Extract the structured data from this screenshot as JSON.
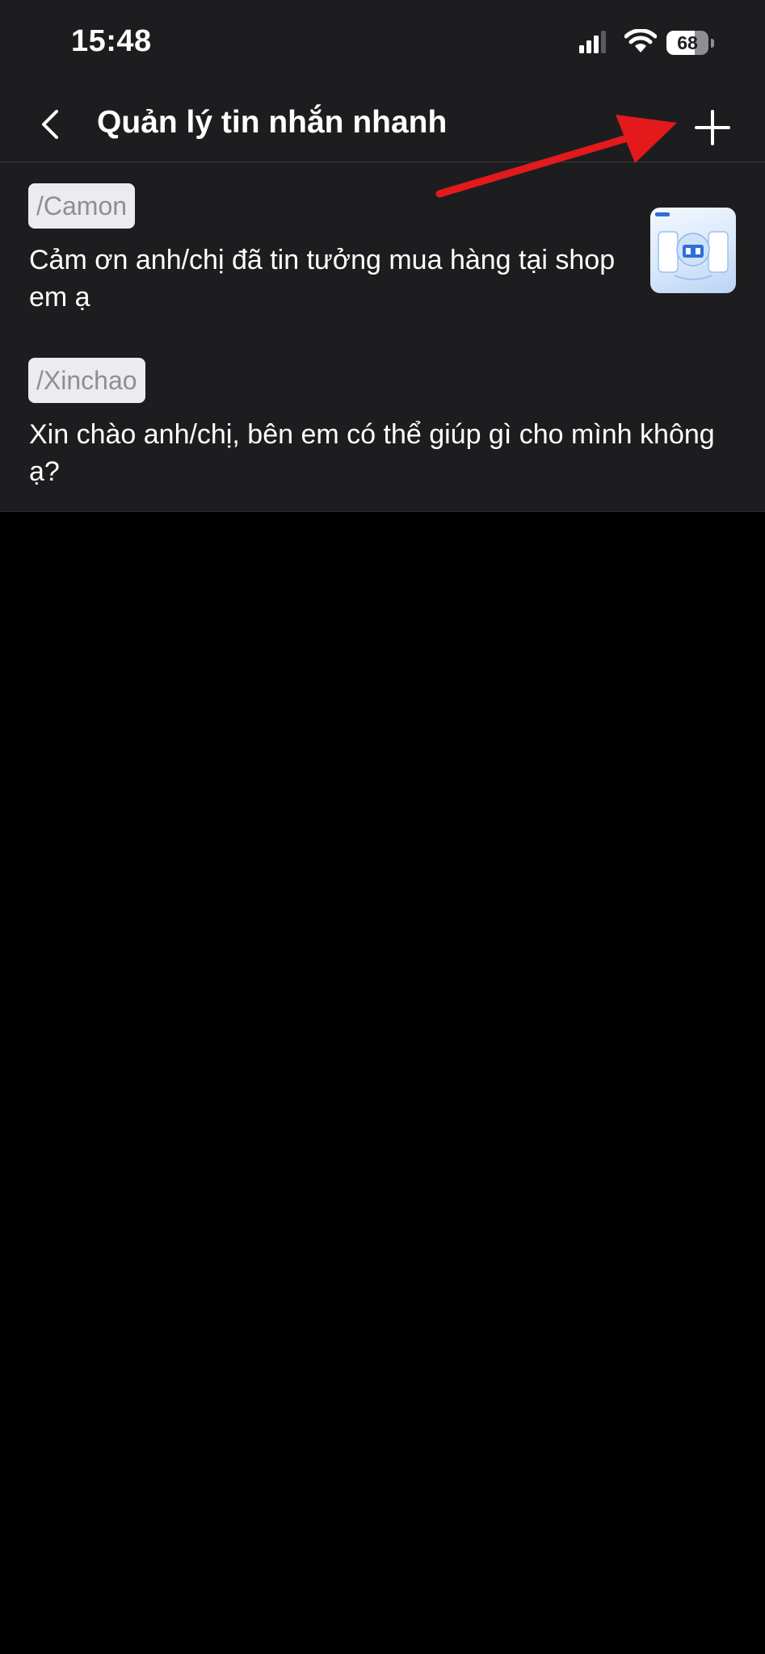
{
  "status_bar": {
    "time": "15:48",
    "battery_percent": "68",
    "battery_level": 0.68,
    "icons": [
      "signal-icon",
      "wifi-icon",
      "battery-icon"
    ]
  },
  "nav": {
    "title": "Quản lý tin nhắn nhanh",
    "back_icon": "chevron-left-icon",
    "add_icon": "plus-icon"
  },
  "quick_messages": [
    {
      "shortcut": "/Camon",
      "text": "Cảm ơn anh/chị đã tin tưởng mua hàng tại shop em ạ",
      "has_image": true
    },
    {
      "shortcut": "/Xinchao",
      "text": "Xin chào anh/chị, bên em có thể giúp gì cho mình không ạ?",
      "has_image": false
    }
  ],
  "colors": {
    "background": "#000000",
    "surface": "#1d1d1f",
    "tag_background": "#ebebf0",
    "tag_text": "#8e8e93",
    "annotation_arrow": "#e3191c"
  }
}
